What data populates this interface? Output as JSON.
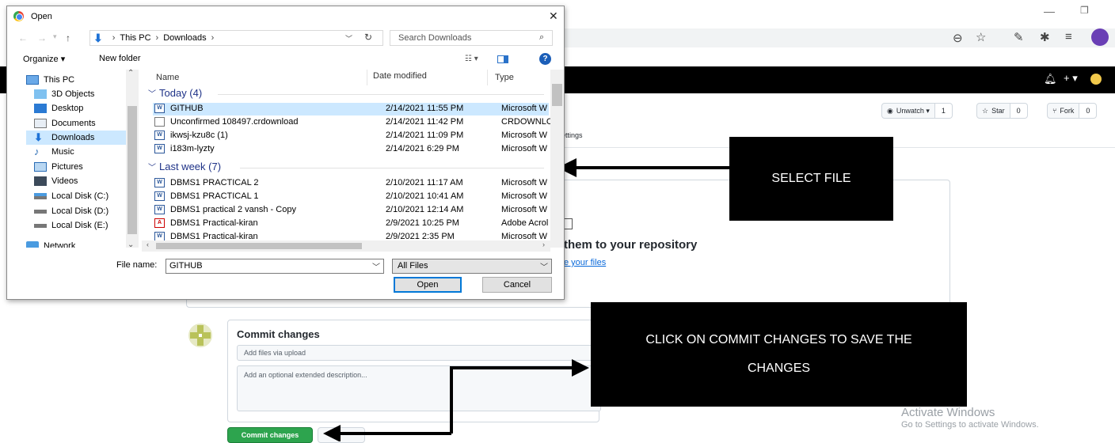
{
  "dialog": {
    "title": "Open",
    "breadcrumb": [
      "This PC",
      "Downloads"
    ],
    "search_placeholder": "Search Downloads",
    "toolbar": {
      "organize": "Organize ▾",
      "new_folder": "New folder"
    },
    "nav_items": [
      {
        "label": "This PC",
        "icon": "computer-icon"
      },
      {
        "label": "3D Objects",
        "icon": "cube-icon"
      },
      {
        "label": "Desktop",
        "icon": "desktop-icon"
      },
      {
        "label": "Documents",
        "icon": "document-icon"
      },
      {
        "label": "Downloads",
        "icon": "download-icon"
      },
      {
        "label": "Music",
        "icon": "music-icon"
      },
      {
        "label": "Pictures",
        "icon": "picture-icon"
      },
      {
        "label": "Videos",
        "icon": "video-icon"
      },
      {
        "label": "Local Disk (C:)",
        "icon": "disk-icon"
      },
      {
        "label": "Local Disk (D:)",
        "icon": "disk-icon"
      },
      {
        "label": "Local Disk (E:)",
        "icon": "disk-icon"
      },
      {
        "label": "Network",
        "icon": "network-icon"
      }
    ],
    "columns": {
      "name": "Name",
      "date": "Date modified",
      "type": "Type"
    },
    "groups": [
      {
        "label": "Today (4)",
        "files": [
          {
            "name": "GITHUB",
            "date": "2/14/2021 11:55 PM",
            "type": "Microsoft W",
            "icon": "word-icon"
          },
          {
            "name": "Unconfirmed 108497.crdownload",
            "date": "2/14/2021 11:42 PM",
            "type": "CRDOWNLC",
            "icon": "blank-file-icon"
          },
          {
            "name": "ikwsj-kzu8c (1)",
            "date": "2/14/2021 11:09 PM",
            "type": "Microsoft W",
            "icon": "word-icon"
          },
          {
            "name": "i183m-lyzty",
            "date": "2/14/2021 6:29 PM",
            "type": "Microsoft W",
            "icon": "word-icon"
          }
        ]
      },
      {
        "label": "Last week (7)",
        "files": [
          {
            "name": "DBMS1 PRACTICAL 2",
            "date": "2/10/2021 11:17 AM",
            "type": "Microsoft W",
            "icon": "word-icon"
          },
          {
            "name": "DBMS1 PRACTICAL 1",
            "date": "2/10/2021 10:41 AM",
            "type": "Microsoft W",
            "icon": "word-icon"
          },
          {
            "name": "DBMS1 practical 2 vansh - Copy",
            "date": "2/10/2021 12:14 AM",
            "type": "Microsoft W",
            "icon": "word-icon"
          },
          {
            "name": "DBMS1 Practical-kiran",
            "date": "2/9/2021 10:25 PM",
            "type": "Adobe Acrol",
            "icon": "pdf-icon"
          },
          {
            "name": "DBMS1 Practical-kiran",
            "date": "2/9/2021 2:35 PM",
            "type": "Microsoft W",
            "icon": "word-icon"
          }
        ]
      }
    ],
    "file_name_label": "File name:",
    "file_name_value": "GITHUB",
    "filter": "All Files",
    "open_label": "Open",
    "cancel_label": "Cancel"
  },
  "github": {
    "unwatch": "Unwatch ▾",
    "unwatch_count": "1",
    "star": "Star",
    "star_count": "0",
    "fork": "Fork",
    "fork_count": "0",
    "settings_tab": "ettings",
    "drop_title": "them to your repository",
    "drop_link": "e your files",
    "commit_title": "Commit changes",
    "commit_summary_placeholder": "Add files via upload",
    "commit_desc_placeholder": "Add an optional extended description...",
    "commit_button": "Commit changes"
  },
  "annotations": {
    "select_file": "SELECT FILE",
    "commit_note": "CLICK ON COMMIT CHANGES TO SAVE THE CHANGES"
  },
  "watermark": {
    "line1": "Activate Windows",
    "line2": "Go to Settings to activate Windows."
  },
  "colors": {
    "accent": "#0078d7",
    "selection": "#cce8ff",
    "commit_green": "#2da44e",
    "annotation": "#000000"
  }
}
